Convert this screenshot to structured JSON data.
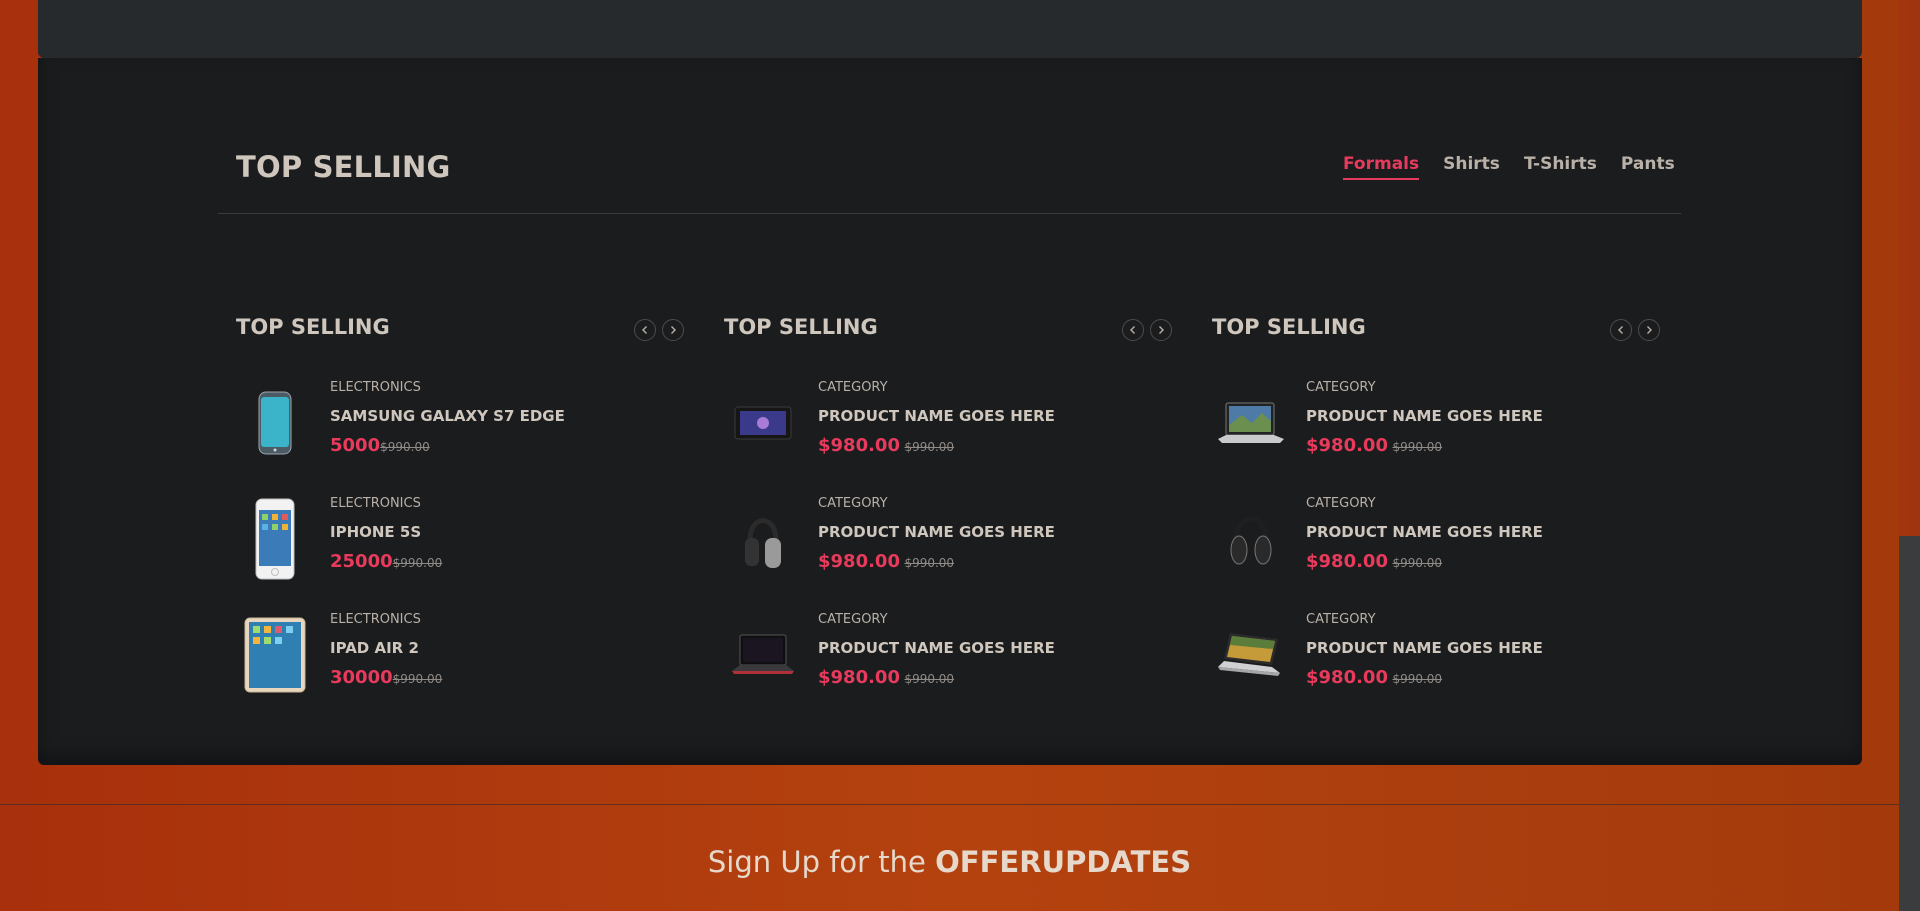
{
  "section_title": "TOP SELLING",
  "tabs": [
    "Formals",
    "Shirts",
    "T-Shirts",
    "Pants"
  ],
  "columns": [
    {
      "title": "TOP SELLING",
      "items": [
        {
          "category": "ELECTRONICS",
          "name": "SAMSUNG GALAXY S7 EDGE",
          "price": "5000",
          "old_price": "$990.00",
          "image": "phone-image"
        },
        {
          "category": "ELECTRONICS",
          "name": "IPHONE 5S",
          "price": "25000",
          "old_price": "$990.00",
          "image": "iphone-image"
        },
        {
          "category": "ELECTRONICS",
          "name": "IPAD AIR 2",
          "price": "30000",
          "old_price": "$990.00",
          "image": "tablet-image"
        }
      ]
    },
    {
      "title": "TOP SELLING",
      "items": [
        {
          "category": "CATEGORY",
          "name": "PRODUCT NAME GOES HERE",
          "price": "$980.00",
          "old_price": "$990.00",
          "image": "tablet-landscape-image"
        },
        {
          "category": "CATEGORY",
          "name": "PRODUCT NAME GOES HERE",
          "price": "$980.00",
          "old_price": "$990.00",
          "image": "headphones-image"
        },
        {
          "category": "CATEGORY",
          "name": "PRODUCT NAME GOES HERE",
          "price": "$980.00",
          "old_price": "$990.00",
          "image": "laptop-image"
        }
      ]
    },
    {
      "title": "TOP SELLING",
      "items": [
        {
          "category": "CATEGORY",
          "name": "PRODUCT NAME GOES HERE",
          "price": "$980.00",
          "old_price": "$990.00",
          "image": "laptop-image"
        },
        {
          "category": "CATEGORY",
          "name": "PRODUCT NAME GOES HERE",
          "price": "$980.00",
          "old_price": "$990.00",
          "image": "headphones-image"
        },
        {
          "category": "CATEGORY",
          "name": "PRODUCT NAME GOES HERE",
          "price": "$980.00",
          "old_price": "$990.00",
          "image": "laptop-image"
        }
      ]
    }
  ],
  "newsletter": {
    "prefix": "Sign Up for the ",
    "highlight": "OFFERUPDATES"
  },
  "colors": {
    "accent": "#e83a5c",
    "panel": "#1b1c1e",
    "page": "#b4420f"
  }
}
